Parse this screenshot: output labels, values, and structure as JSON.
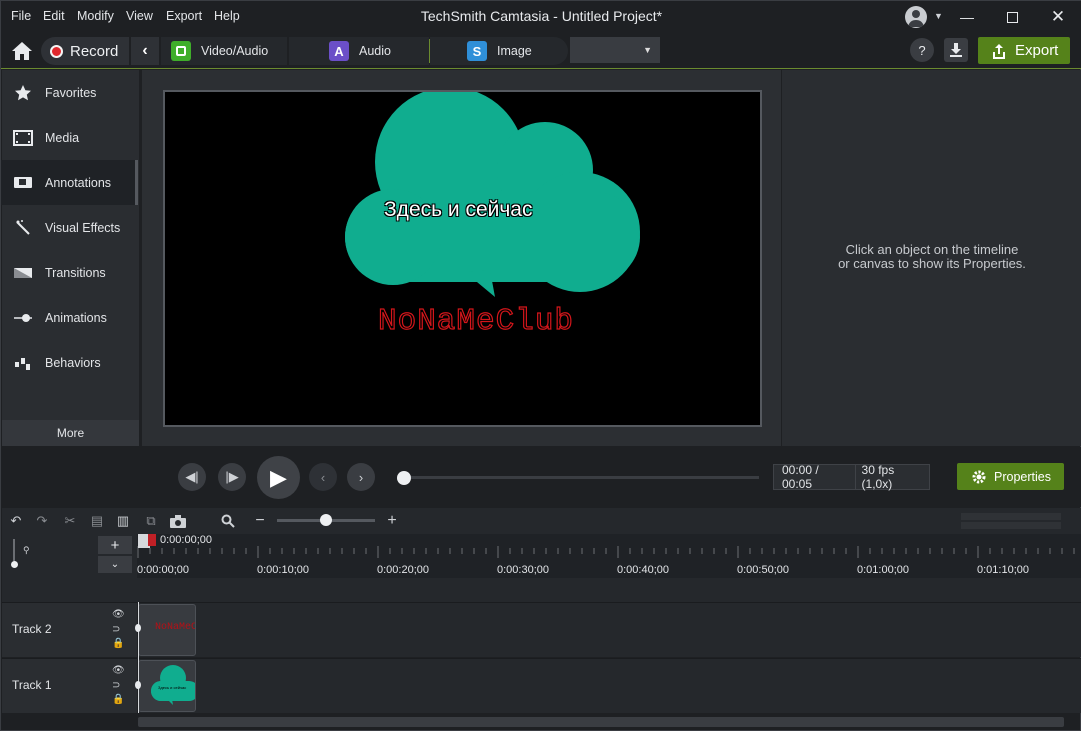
{
  "menu": [
    "File",
    "Edit",
    "Modify",
    "View",
    "Export",
    "Help"
  ],
  "window_title": "TechSmith Camtasia - Untitled Project*",
  "toolbar": {
    "record_label": "Record",
    "tabs": [
      {
        "label": "Video/Audio",
        "icon": "video-audio-icon",
        "color": "#3fae2a"
      },
      {
        "label": "Audio",
        "icon": "audio-icon",
        "color": "#6b4fc8"
      },
      {
        "label": "Image",
        "icon": "image-icon",
        "color": "#2f8fd8"
      }
    ],
    "export_label": "Export",
    "help_label": "?"
  },
  "sidebar": {
    "items": [
      {
        "label": "Favorites",
        "icon": "star-icon"
      },
      {
        "label": "Media",
        "icon": "film-icon"
      },
      {
        "label": "Annotations",
        "icon": "annotation-icon"
      },
      {
        "label": "Visual Effects",
        "icon": "magic-wand-icon"
      },
      {
        "label": "Transitions",
        "icon": "transitions-icon"
      },
      {
        "label": "Animations",
        "icon": "animations-icon"
      },
      {
        "label": "Behaviors",
        "icon": "behaviors-icon"
      }
    ],
    "active_index": 2,
    "more_label": "More"
  },
  "canvas": {
    "callout_text": "Здесь и сейчас",
    "callout_color": "#10ad8f",
    "logo_text": "NoNaMeClub",
    "logo_color": "#d4161b"
  },
  "properties": {
    "placeholder_line1": "Click an object on the timeline",
    "placeholder_line2": "or canvas to show its Properties."
  },
  "playback": {
    "current_time": "00:00",
    "separator": "/",
    "duration": "00:05",
    "fps": "30 fps (1,0x)",
    "progress": 0,
    "properties_label": "Properties"
  },
  "timeline": {
    "playhead_time": "0:00:00;00",
    "ticks": [
      "0:00:00;00",
      "0:00:10;00",
      "0:00:20;00",
      "0:00:30;00",
      "0:00:40;00",
      "0:00:50;00",
      "0:01:00;00",
      "0:01:10;00"
    ],
    "zoom": 0.5,
    "tracks": [
      {
        "label": "Track 2",
        "clip_text": "NoNaMeC"
      },
      {
        "label": "Track 1",
        "clip_text": "Здесь и сейчас"
      }
    ]
  },
  "colors": {
    "accent_green": "#55821a",
    "record_red": "#e0282d"
  }
}
